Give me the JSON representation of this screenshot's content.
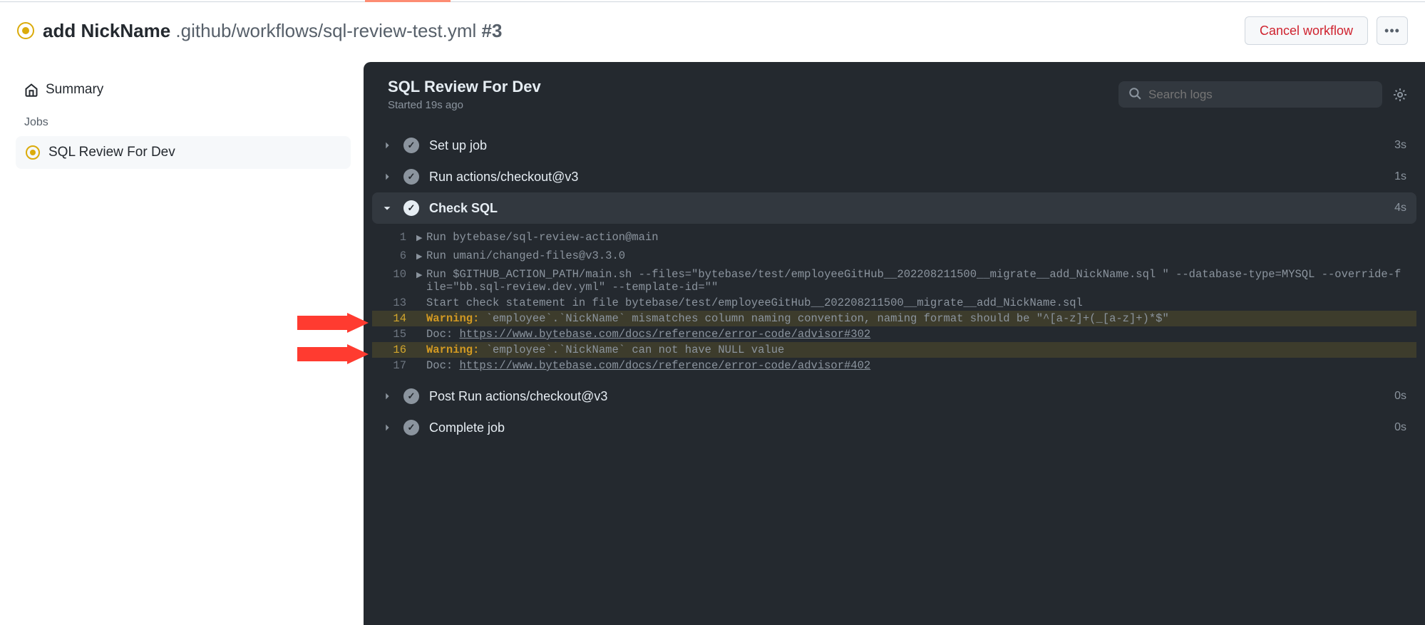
{
  "header": {
    "title_bold": "add NickName",
    "title_path": ".github/workflows/sql-review-test.yml",
    "title_run": "#3",
    "cancel_label": "Cancel workflow"
  },
  "sidebar": {
    "summary_label": "Summary",
    "jobs_label": "Jobs",
    "jobs": [
      {
        "label": "SQL Review For Dev"
      }
    ]
  },
  "panel": {
    "title": "SQL Review For Dev",
    "subtitle": "Started 19s ago",
    "search_placeholder": "Search logs"
  },
  "steps": [
    {
      "name": "Set up job",
      "duration": "3s",
      "expanded": false
    },
    {
      "name": "Run actions/checkout@v3",
      "duration": "1s",
      "expanded": false
    },
    {
      "name": "Check SQL",
      "duration": "4s",
      "expanded": true
    },
    {
      "name": "Post Run actions/checkout@v3",
      "duration": "0s",
      "expanded": false
    },
    {
      "name": "Complete job",
      "duration": "0s",
      "expanded": false
    }
  ],
  "log": {
    "l1": {
      "num": "1",
      "tri": true,
      "text": "Run bytebase/sql-review-action@main"
    },
    "l6": {
      "num": "6",
      "tri": true,
      "text": "Run umani/changed-files@v3.3.0"
    },
    "l10": {
      "num": "10",
      "tri": true,
      "text": "Run $GITHUB_ACTION_PATH/main.sh --files=\"bytebase/test/employeeGitHub__202208211500__migrate__add_NickName.sql \" --database-type=MYSQL --override-file=\"bb.sql-review.dev.yml\" --template-id=\"\""
    },
    "l13": {
      "num": "13",
      "text": "Start check statement in file bytebase/test/employeeGitHub__202208211500__migrate__add_NickName.sql"
    },
    "l14": {
      "num": "14",
      "warn": "Warning:",
      "text": " `employee`.`NickName` mismatches column naming convention, naming format should be \"^[a-z]+(_[a-z]+)*$\""
    },
    "l15": {
      "num": "15",
      "doc": "Doc: ",
      "link": "https://www.bytebase.com/docs/reference/error-code/advisor#302"
    },
    "l16": {
      "num": "16",
      "warn": "Warning:",
      "text": " `employee`.`NickName` can not have NULL value"
    },
    "l17": {
      "num": "17",
      "doc": "Doc: ",
      "link": "https://www.bytebase.com/docs/reference/error-code/advisor#402"
    }
  }
}
